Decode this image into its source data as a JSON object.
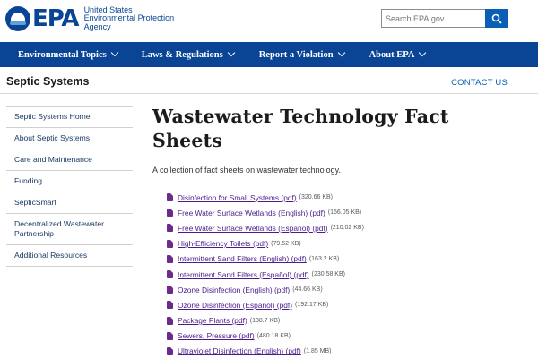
{
  "header": {
    "logo_text": "EPA",
    "agency_lines": [
      "United States",
      "Environmental Protection",
      "Agency"
    ],
    "search_placeholder": "Search EPA.gov"
  },
  "nav": {
    "items": [
      {
        "label": "Environmental Topics"
      },
      {
        "label": "Laws & Regulations"
      },
      {
        "label": "Report a Violation"
      },
      {
        "label": "About EPA"
      }
    ]
  },
  "section": {
    "title": "Septic Systems",
    "contact_label": "CONTACT US"
  },
  "sidebar": {
    "items": [
      {
        "label": "Septic Systems Home"
      },
      {
        "label": "About Septic Systems"
      },
      {
        "label": "Care and Maintenance"
      },
      {
        "label": "Funding"
      },
      {
        "label": "SepticSmart"
      },
      {
        "label": "Decentralized Wastewater Partnership"
      },
      {
        "label": "Additional Resources"
      }
    ]
  },
  "main": {
    "title": "Wastewater Technology Fact Sheets",
    "lead": "A collection of fact sheets on wastewater technology.",
    "documents": [
      {
        "label": "Disinfection for Small Systems (pdf)",
        "size": "(320.66 KB)"
      },
      {
        "label": "Free Water Surface Wetlands (English) (pdf)",
        "size": "(166.05 KB)"
      },
      {
        "label": "Free Water Surface Wetlands (Español) (pdf)",
        "size": "(210.02 KB)"
      },
      {
        "label": "High-Efficiency Toilets (pdf)",
        "size": "(79.52 KB)"
      },
      {
        "label": "Intermittent Sand Filters (English) (pdf)",
        "size": "(163.2 KB)"
      },
      {
        "label": "Intermittent Sand Filters (Español) (pdf)",
        "size": "(230.58 KB)"
      },
      {
        "label": "Ozone Disinfection (English) (pdf)",
        "size": "(44.66 KB)"
      },
      {
        "label": "Ozone Disinfection (Español) (pdf)",
        "size": "(192.17 KB)"
      },
      {
        "label": "Package Plants (pdf)",
        "size": "(138.7 KB)"
      },
      {
        "label": "Sewers, Pressure (pdf)",
        "size": "(480.18 KB)"
      },
      {
        "label": "Ultraviolet Disinfection (English) (pdf)",
        "size": "(1.85 MB)"
      }
    ]
  },
  "colors": {
    "brand": "#0a4595",
    "link_visited": "#4b1d8a",
    "pdf_icon": "#6b2a8c"
  }
}
